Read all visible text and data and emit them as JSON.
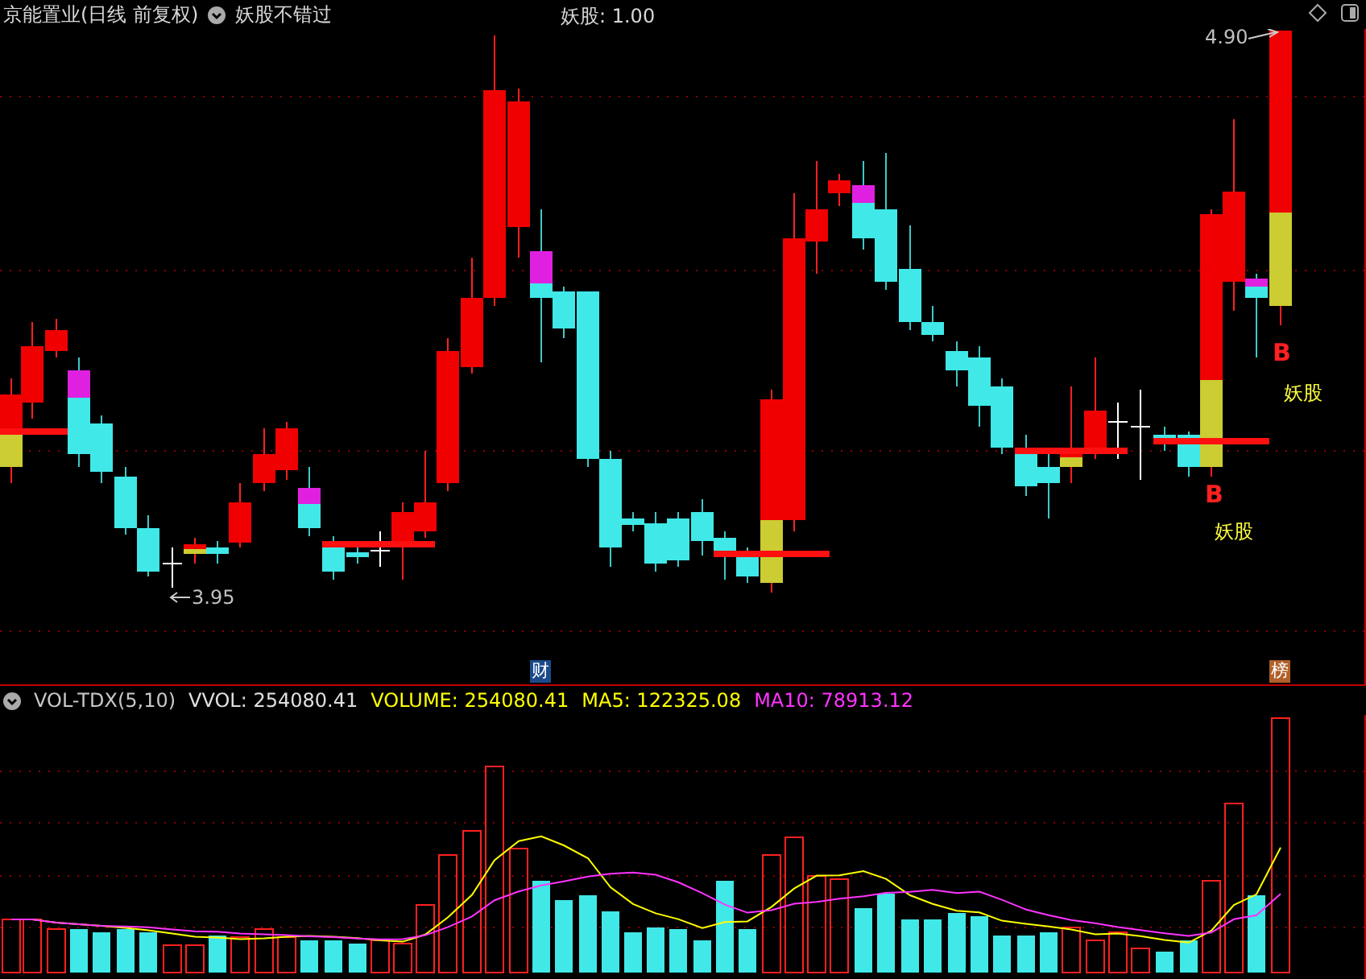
{
  "header": {
    "stock_title": "京能置业(日线 前复权)",
    "indicator_name": "妖股不错过",
    "indicator_value": "妖股: 1.00"
  },
  "price_chart": {
    "high_label": "4.90",
    "low_label": "3.95",
    "signals": [
      {
        "letter": "B",
        "caption": "妖股"
      },
      {
        "letter": "B",
        "caption": "妖股"
      }
    ],
    "badges": [
      {
        "text": "财",
        "color": "#1a4a8a"
      },
      {
        "text": "榜",
        "color": "#b0602a"
      }
    ]
  },
  "volume_panel": {
    "legend": [
      {
        "text": "VOL-TDX(5,10)",
        "color": "#c8c8c8"
      },
      {
        "text": "VVOL: 254080.41",
        "color": "#e0e0e0"
      },
      {
        "text": "VOLUME: 254080.41",
        "color": "#ffff00"
      },
      {
        "text": "MA5: 122325.08",
        "color": "#ffff00"
      },
      {
        "text": "MA10: 78913.12",
        "color": "#ff33ff"
      }
    ]
  }
}
